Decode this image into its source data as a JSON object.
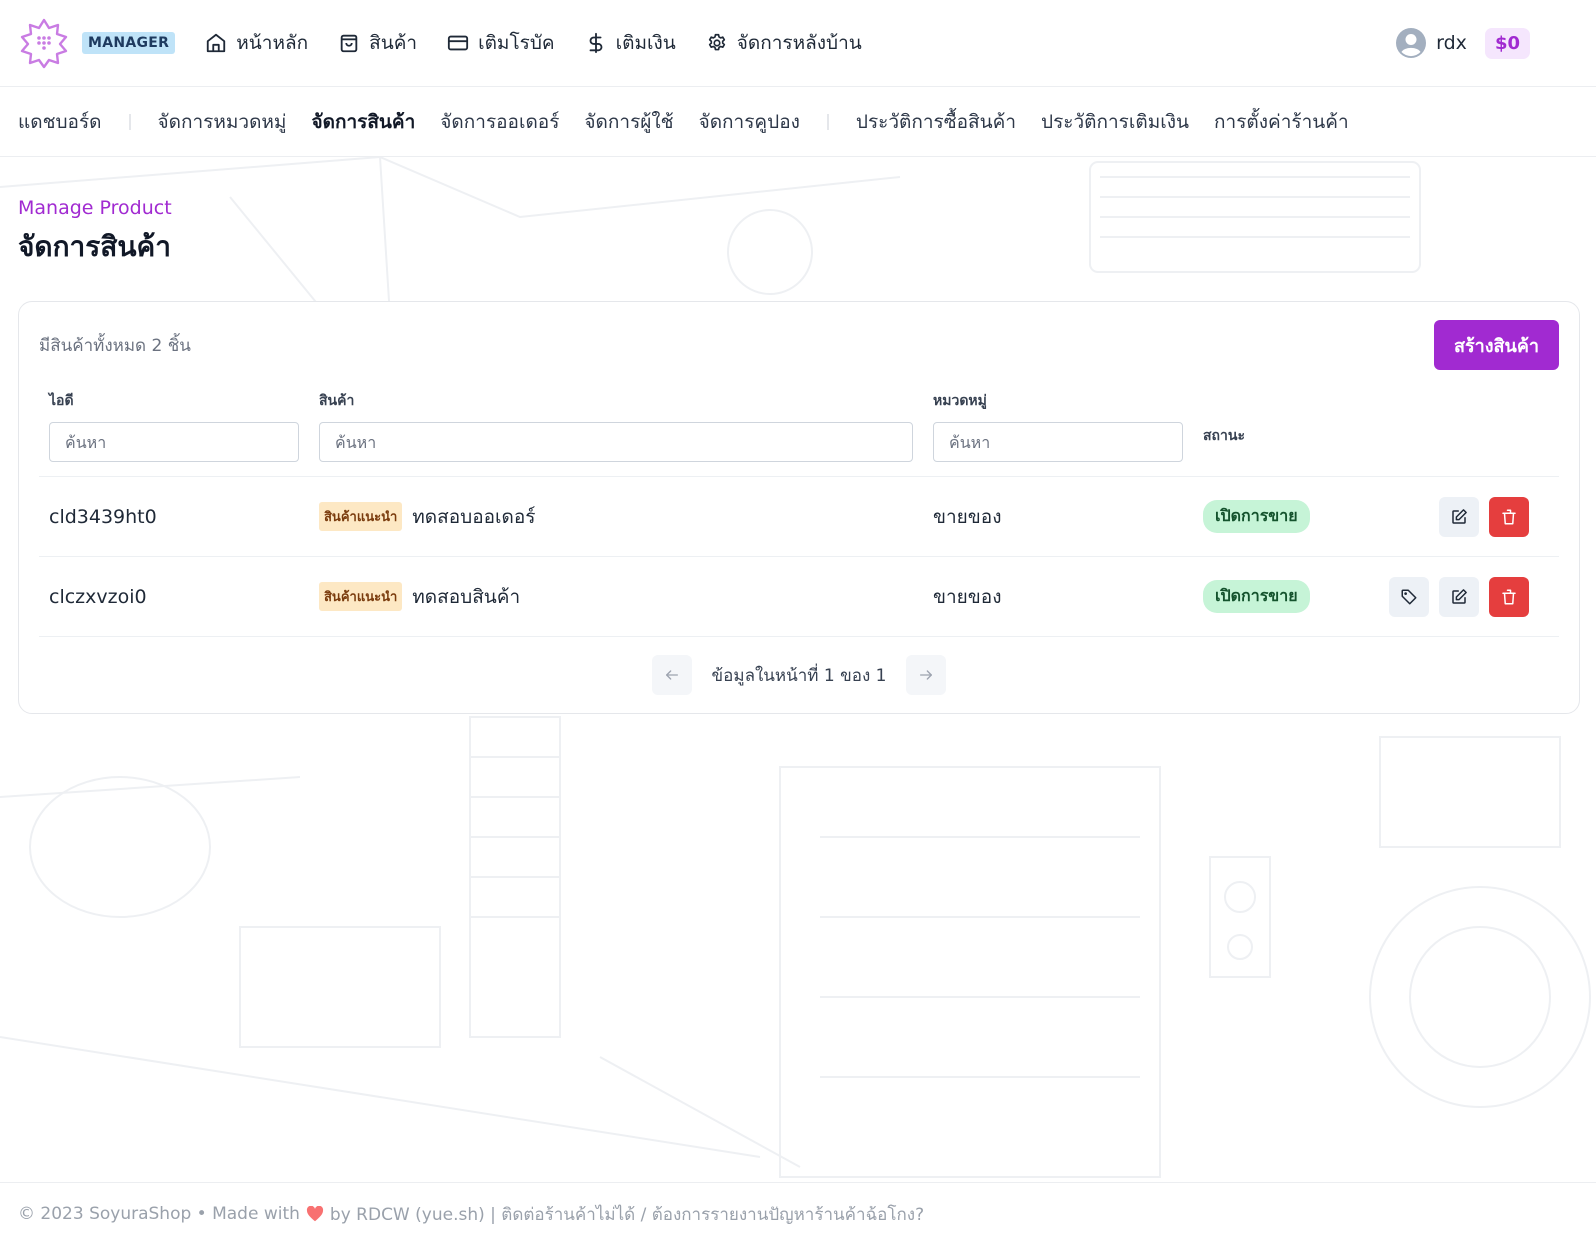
{
  "header": {
    "role_badge": "MANAGER",
    "nav": [
      {
        "icon": "home-icon",
        "label": "หน้าหลัก"
      },
      {
        "icon": "shopping-bag-icon",
        "label": "สินค้า"
      },
      {
        "icon": "credit-card-icon",
        "label": "เติมโรบัค"
      },
      {
        "icon": "dollar-icon",
        "label": "เติมเงิน"
      },
      {
        "icon": "gear-icon",
        "label": "จัดการหลังบ้าน"
      }
    ],
    "username": "rdx",
    "balance": "$0"
  },
  "subnav": {
    "items": [
      {
        "label": "แดชบอร์ด",
        "active": false
      },
      {
        "label": "จัดการหมวดหมู่",
        "active": false
      },
      {
        "label": "จัดการสินค้า",
        "active": true
      },
      {
        "label": "จัดการออเดอร์",
        "active": false
      },
      {
        "label": "จัดการผู้ใช้",
        "active": false
      },
      {
        "label": "จัดการคูปอง",
        "active": false
      },
      {
        "label": "ประวัติการซื้อสินค้า",
        "active": false
      },
      {
        "label": "ประวัติการเติมเงิน",
        "active": false
      },
      {
        "label": "การตั้งค่าร้านค้า",
        "active": false
      }
    ]
  },
  "page": {
    "eyebrow": "Manage Product",
    "title": "จัดการสินค้า"
  },
  "card": {
    "count_text": "มีสินค้าทั้งหมด 2 ชิ้น",
    "create_button": "สร้างสินค้า",
    "columns": {
      "id": {
        "label": "ไอดี",
        "placeholder": "ค้นหา",
        "value": ""
      },
      "product": {
        "label": "สินค้า",
        "placeholder": "ค้นหา",
        "value": ""
      },
      "category": {
        "label": "หมวดหมู่",
        "placeholder": "ค้นหา",
        "value": ""
      },
      "status": {
        "label": "สถานะ"
      }
    },
    "rows": [
      {
        "id": "cld3439ht0",
        "tag": "สินค้าแนะนำ",
        "name": "ทดสอบออเดอร์",
        "category": "ขายของ",
        "status": "เปิดการขาย",
        "actions": [
          "edit-icon",
          "trash-icon"
        ]
      },
      {
        "id": "clczxvzoi0",
        "tag": "สินค้าแนะนำ",
        "name": "ทดสอบสินค้า",
        "category": "ขายของ",
        "status": "เปิดการขาย",
        "actions": [
          "tag-icon",
          "edit-icon",
          "trash-icon"
        ]
      }
    ],
    "pagination": {
      "text": "ข้อมูลในหน้าที่ 1 ของ 1",
      "current_page": 1,
      "total_pages": 1
    }
  },
  "footer": {
    "prefix": "© 2023 SoyuraShop • Made with",
    "suffix": "by RDCW (yue.sh) | ติดต่อร้านค้าไม่ได้ / ต้องการรายงานปัญหาร้านค้าฉ้อโกง?"
  },
  "colors": {
    "accent": "#a12ad1",
    "danger": "#e53e3e",
    "status_bg": "#c6f4d7",
    "tag_bg": "#fde8c4",
    "role_badge_bg": "#bfe3f8"
  }
}
